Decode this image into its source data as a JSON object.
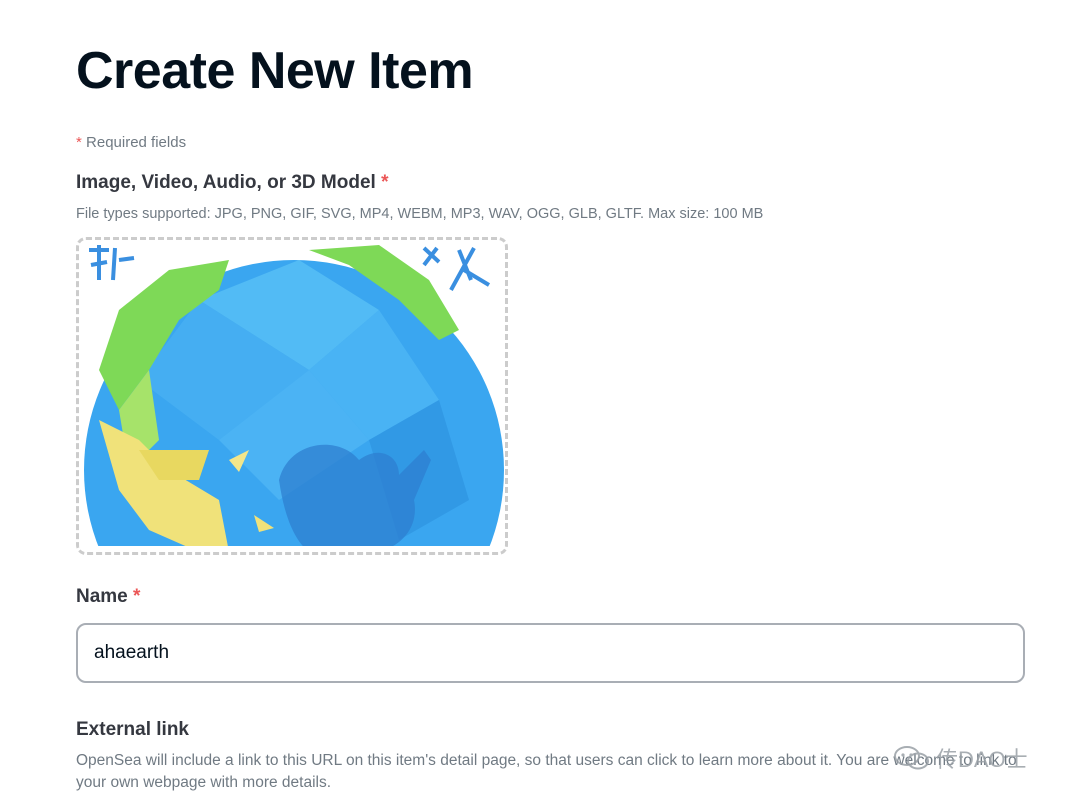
{
  "page": {
    "title": "Create New Item",
    "required_note_star": "*",
    "required_note": "Required fields"
  },
  "media": {
    "label": "Image, Video, Audio, or 3D Model",
    "required_star": "*",
    "file_types": "File types supported: JPG, PNG, GIF, SVG, MP4, WEBM, MP3, WAV, OGG, GLB, GLTF. Max size: 100 MB"
  },
  "name": {
    "label": "Name",
    "required_star": "*",
    "value": "ahaearth"
  },
  "external_link": {
    "label": "External link",
    "help": "OpenSea will include a link to this URL on this item's detail page, so that users can click to learn more about it. You are welcome to link to your own webpage with more details."
  },
  "watermark": {
    "text": "传DAO士",
    "icon": "wechat-icon"
  },
  "colors": {
    "required": "#eb5757",
    "label": "#353840",
    "muted": "#707a83",
    "globe_ocean": "#3aa6f0",
    "globe_land_green": "#7ed957",
    "globe_land_yellow": "#f0e27a"
  }
}
